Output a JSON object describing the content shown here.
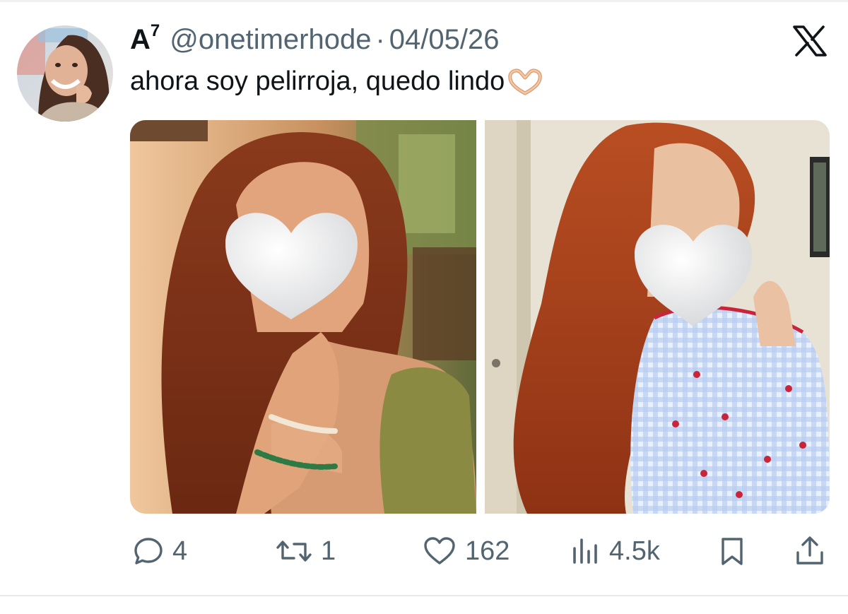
{
  "tweet": {
    "display_name": "A",
    "display_name_sup": "7",
    "handle": "@onetimerhode",
    "separator": "·",
    "date": "04/05/26",
    "text": "ahora soy pelirroja, quedo lindo",
    "emoji_icon": "heart-hands-icon"
  },
  "media": {
    "count": 2,
    "images": [
      {
        "name": "left-photo",
        "description_icon": "redhead-selfie-heart-face"
      },
      {
        "name": "right-photo",
        "description_icon": "redhead-gingham-shirt-heart-face"
      }
    ]
  },
  "actions": {
    "reply_count": "4",
    "repost_count": "1",
    "like_count": "162",
    "views_count": "4.5k",
    "icons": [
      "reply-icon",
      "repost-icon",
      "like-icon",
      "views-icon",
      "bookmark-icon",
      "share-icon"
    ]
  },
  "colors": {
    "text_primary": "#0f1419",
    "text_secondary": "#536471",
    "background": "#ffffff"
  }
}
